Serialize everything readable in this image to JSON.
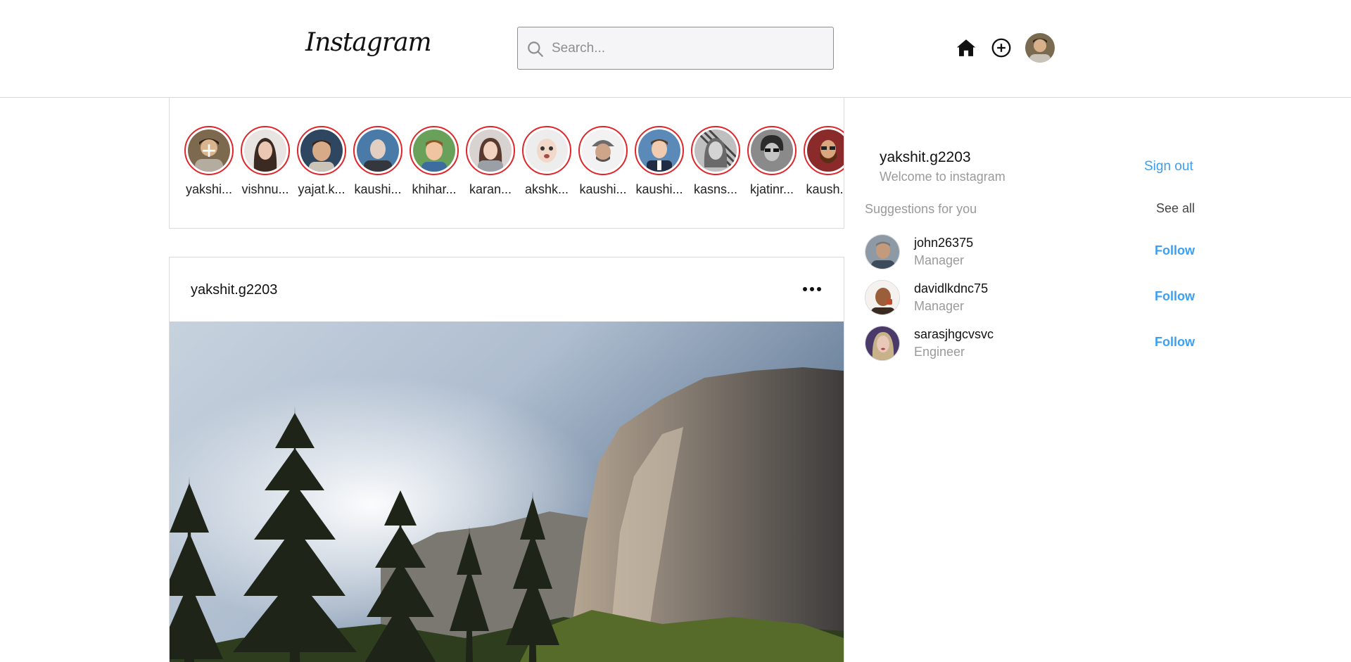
{
  "header": {
    "logo": "Instagram",
    "search_placeholder": "Search...",
    "icons": [
      "home-icon",
      "add-post-icon",
      "profile-avatar"
    ]
  },
  "stories": [
    {
      "name": "yakshi...",
      "is_add": true
    },
    {
      "name": "vishnu..."
    },
    {
      "name": "yajat.k..."
    },
    {
      "name": "kaushi..."
    },
    {
      "name": "khihar..."
    },
    {
      "name": "karan..."
    },
    {
      "name": "akshk..."
    },
    {
      "name": "kaushi..."
    },
    {
      "name": "kaushi..."
    },
    {
      "name": "kasns..."
    },
    {
      "name": "kjatinr..."
    },
    {
      "name": "kaush..."
    }
  ],
  "post": {
    "username": "yakshit.g2203",
    "more_icon": "more-horizontal-icon"
  },
  "sidebar": {
    "user": {
      "username": "yakshit.g2203",
      "subtitle": "Welcome to instagram",
      "sign_out": "Sign out"
    },
    "suggestions_title": "Suggestions for you",
    "see_all": "See all",
    "suggestions": [
      {
        "username": "john26375",
        "role": "Manager",
        "action": "Follow"
      },
      {
        "username": "davidlkdnc75",
        "role": "Manager",
        "action": "Follow"
      },
      {
        "username": "sarasjhgcvsvc",
        "role": "Engineer",
        "action": "Follow"
      }
    ]
  },
  "colors": {
    "story_ring": "#e0262b",
    "link_blue": "#3d9ff0",
    "border": "#dbdbdb",
    "muted_text": "#9a9a9a"
  }
}
